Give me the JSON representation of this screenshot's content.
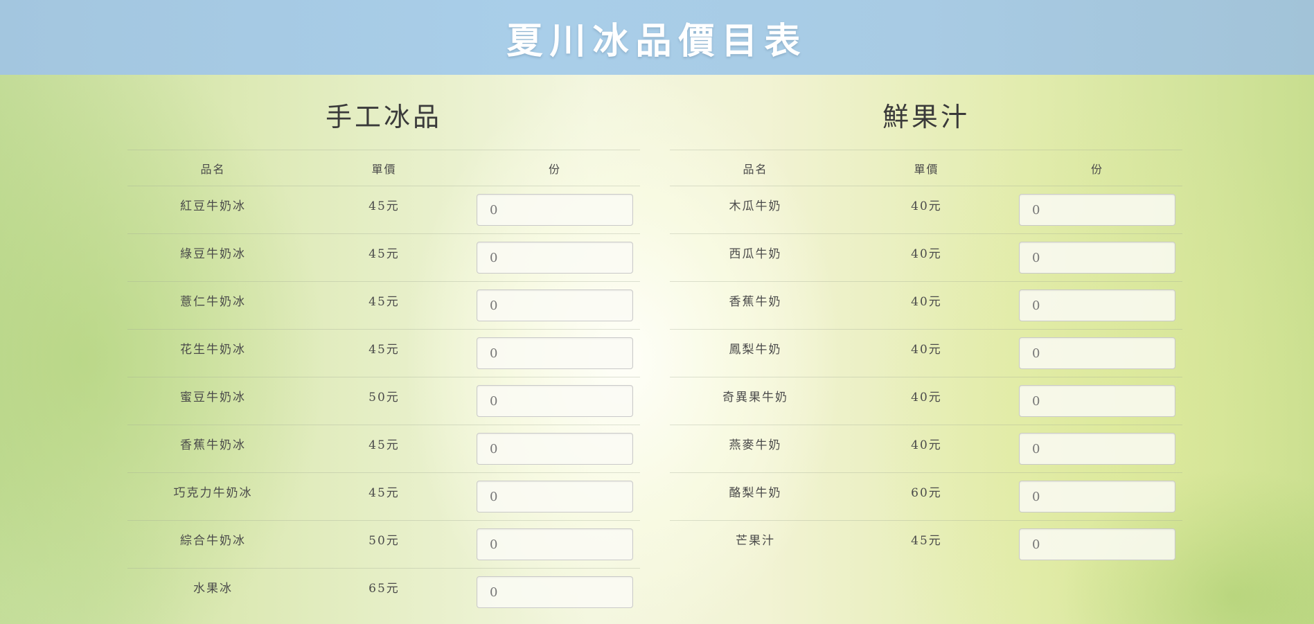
{
  "header": {
    "title": "夏川冰品價目表"
  },
  "sections": [
    {
      "title": "手工冰品",
      "columns": [
        "品名",
        "單價",
        "份"
      ],
      "items": [
        {
          "name": "紅豆牛奶冰",
          "price": "45元",
          "qty": "0"
        },
        {
          "name": "綠豆牛奶冰",
          "price": "45元",
          "qty": "0"
        },
        {
          "name": "薏仁牛奶冰",
          "price": "45元",
          "qty": "0"
        },
        {
          "name": "花生牛奶冰",
          "price": "45元",
          "qty": "0"
        },
        {
          "name": "蜜豆牛奶冰",
          "price": "50元",
          "qty": "0"
        },
        {
          "name": "香蕉牛奶冰",
          "price": "45元",
          "qty": "0"
        },
        {
          "name": "巧克力牛奶冰",
          "price": "45元",
          "qty": "0"
        },
        {
          "name": "綜合牛奶冰",
          "price": "50元",
          "qty": "0"
        },
        {
          "name": "水果冰",
          "price": "65元",
          "qty": "0"
        }
      ]
    },
    {
      "title": "鮮果汁",
      "columns": [
        "品名",
        "單價",
        "份"
      ],
      "items": [
        {
          "name": "木瓜牛奶",
          "price": "40元",
          "qty": "0"
        },
        {
          "name": "西瓜牛奶",
          "price": "40元",
          "qty": "0"
        },
        {
          "name": "香蕉牛奶",
          "price": "40元",
          "qty": "0"
        },
        {
          "name": "鳳梨牛奶",
          "price": "40元",
          "qty": "0"
        },
        {
          "name": "奇異果牛奶",
          "price": "40元",
          "qty": "0"
        },
        {
          "name": "燕麥牛奶",
          "price": "40元",
          "qty": "0"
        },
        {
          "name": "酪梨牛奶",
          "price": "60元",
          "qty": "0"
        },
        {
          "name": "芒果汁",
          "price": "45元",
          "qty": "0"
        }
      ]
    }
  ]
}
